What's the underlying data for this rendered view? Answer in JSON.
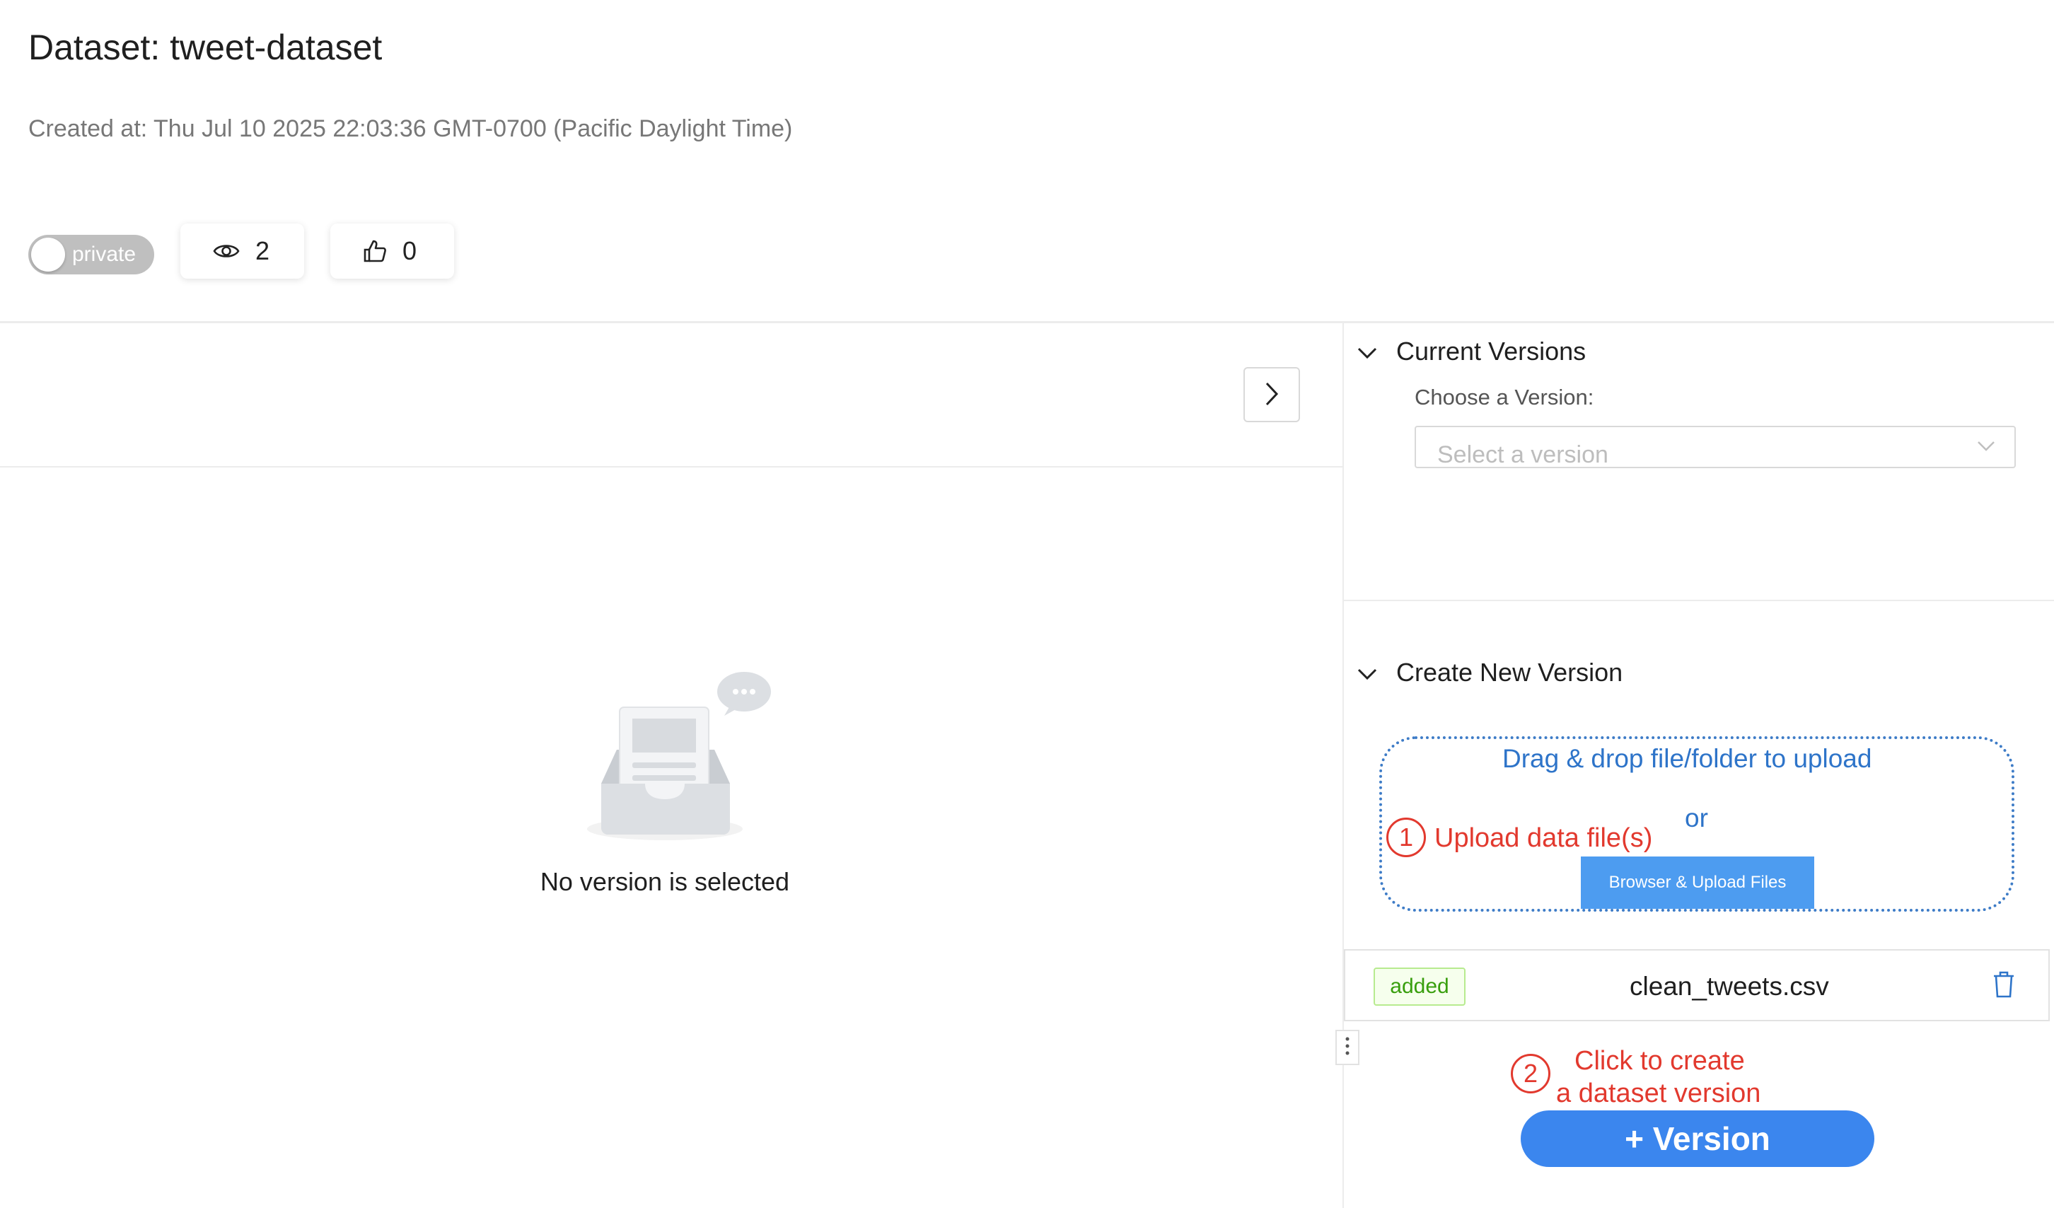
{
  "header": {
    "title": "Dataset: tweet-dataset",
    "created_at": "Created at: Thu Jul 10 2025 22:03:36 GMT-0700 (Pacific Daylight Time)"
  },
  "visibility": {
    "label": "private",
    "is_public": false
  },
  "stats": {
    "views": "2",
    "likes": "0"
  },
  "empty_state": {
    "message": "No version is selected"
  },
  "current_versions": {
    "title": "Current Versions",
    "choose_label": "Choose a Version:",
    "select_placeholder": "Select a version"
  },
  "create_version": {
    "title": "Create New Version",
    "dropzone_text": "Drag & drop file/folder to upload",
    "or_text": "or",
    "browse_button": "Browser & Upload Files",
    "files": [
      {
        "status": "added",
        "name": "clean_tweets.csv"
      }
    ],
    "version_button": "+ Version"
  },
  "annotations": {
    "step1_number": "1",
    "step1_text": "Upload data file(s)",
    "step2_number": "2",
    "step2_line1": "Click to create",
    "step2_line2": "a dataset version"
  },
  "colors": {
    "annotation_red": "#e2392e",
    "link_blue": "#2e74c9",
    "primary_button": "#3b86ee",
    "tag_green": "#389e0d"
  }
}
